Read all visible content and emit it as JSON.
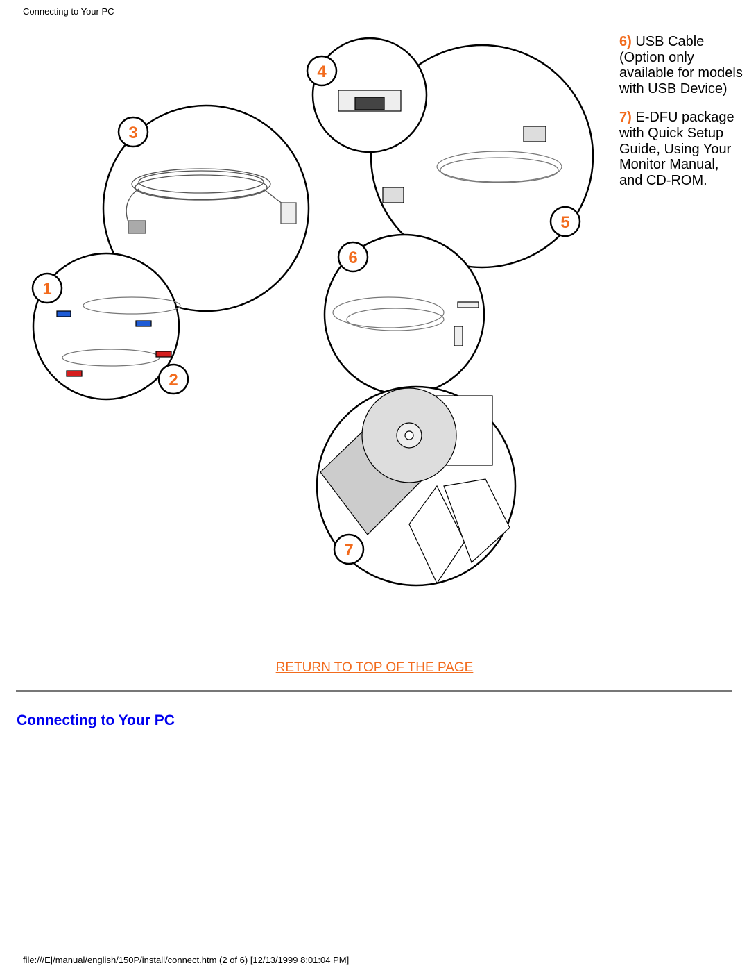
{
  "page_header": "Connecting to Your PC",
  "illustration": {
    "callouts": [
      "1",
      "2",
      "3",
      "4",
      "5",
      "6",
      "7"
    ],
    "accent_color": "#f26b1d"
  },
  "side_notes": [
    {
      "number": "6)",
      "text": "USB Cable (Option only available for models with USB Device)"
    },
    {
      "number": "7)",
      "text": "E-DFU package with Quick Setup Guide, Using Your Monitor Manual, and CD-ROM."
    }
  ],
  "return_link": "RETURN TO TOP OF THE PAGE",
  "section_title": "Connecting to Your PC",
  "footer": "file:///E|/manual/english/150P/install/connect.htm (2 of 6) [12/13/1999 8:01:04 PM]"
}
